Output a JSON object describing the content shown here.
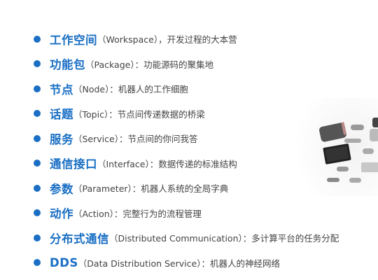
{
  "accent_color": "#1a6fc4",
  "items": [
    {
      "term": "工作空间",
      "desc": "（Workspace），开发过程的大本营"
    },
    {
      "term": "功能包",
      "desc": "（Package）：功能源码的聚集地"
    },
    {
      "term": "节点",
      "desc": "（Node）：机器人的工作细胞"
    },
    {
      "term": "话题",
      "desc": "（Topic）：节点间传递数据的桥梁"
    },
    {
      "term": "服务",
      "desc": "（Service）：节点间的你问我答"
    },
    {
      "term": "通信接口",
      "desc": "（Interface）：数据传递的标准结构"
    },
    {
      "term": "参数",
      "desc": "（Parameter）：机器人系统的全局字典"
    },
    {
      "term": "动作",
      "desc": "（Action）：完整行为的流程管理"
    },
    {
      "term": "分布式通信",
      "desc": "（Distributed Communication）：多计算平台的任务分配"
    },
    {
      "term": "DDS",
      "desc": "（Data Distribution Service）：机器人的神经网络"
    }
  ]
}
